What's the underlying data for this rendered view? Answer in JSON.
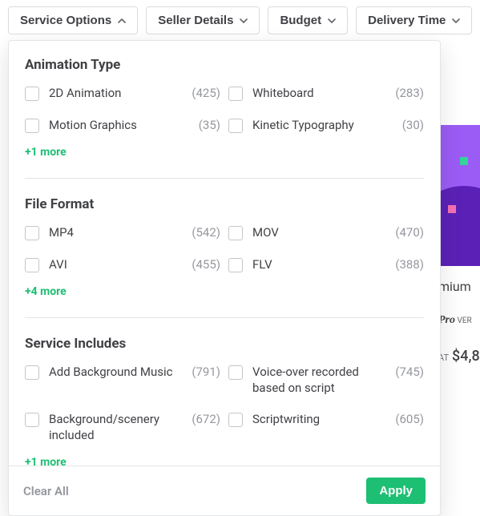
{
  "filter_bar": {
    "service_options": "Service Options",
    "seller_details": "Seller Details",
    "budget": "Budget",
    "delivery_time": "Delivery Time"
  },
  "panel": {
    "sections": {
      "animation_type": {
        "title": "Animation Type",
        "options": [
          {
            "label": "2D Animation",
            "count": "(425)"
          },
          {
            "label": "Whiteboard",
            "count": "(283)"
          },
          {
            "label": "Motion Graphics",
            "count": "(35)"
          },
          {
            "label": "Kinetic Typography",
            "count": "(30)"
          }
        ],
        "more": "+1 more"
      },
      "file_format": {
        "title": "File Format",
        "options": [
          {
            "label": "MP4",
            "count": "(542)"
          },
          {
            "label": "MOV",
            "count": "(470)"
          },
          {
            "label": "AVI",
            "count": "(455)"
          },
          {
            "label": "FLV",
            "count": "(388)"
          }
        ],
        "more": "+4 more"
      },
      "service_includes": {
        "title": "Service Includes",
        "options": [
          {
            "label": "Add Background Music",
            "count": "(791)"
          },
          {
            "label": "Voice-over recorded based on script",
            "count": "(745)"
          },
          {
            "label": "Background/scenery included",
            "count": "(672)"
          },
          {
            "label": "Scriptwriting",
            "count": "(605)"
          }
        ],
        "more": "+1 more"
      }
    },
    "footer": {
      "clear": "Clear All",
      "apply": "Apply"
    }
  },
  "bg_card": {
    "mium": "mium",
    "name": "Pro",
    "ver": " VER",
    "at": "AT",
    "price": "$4,8"
  }
}
